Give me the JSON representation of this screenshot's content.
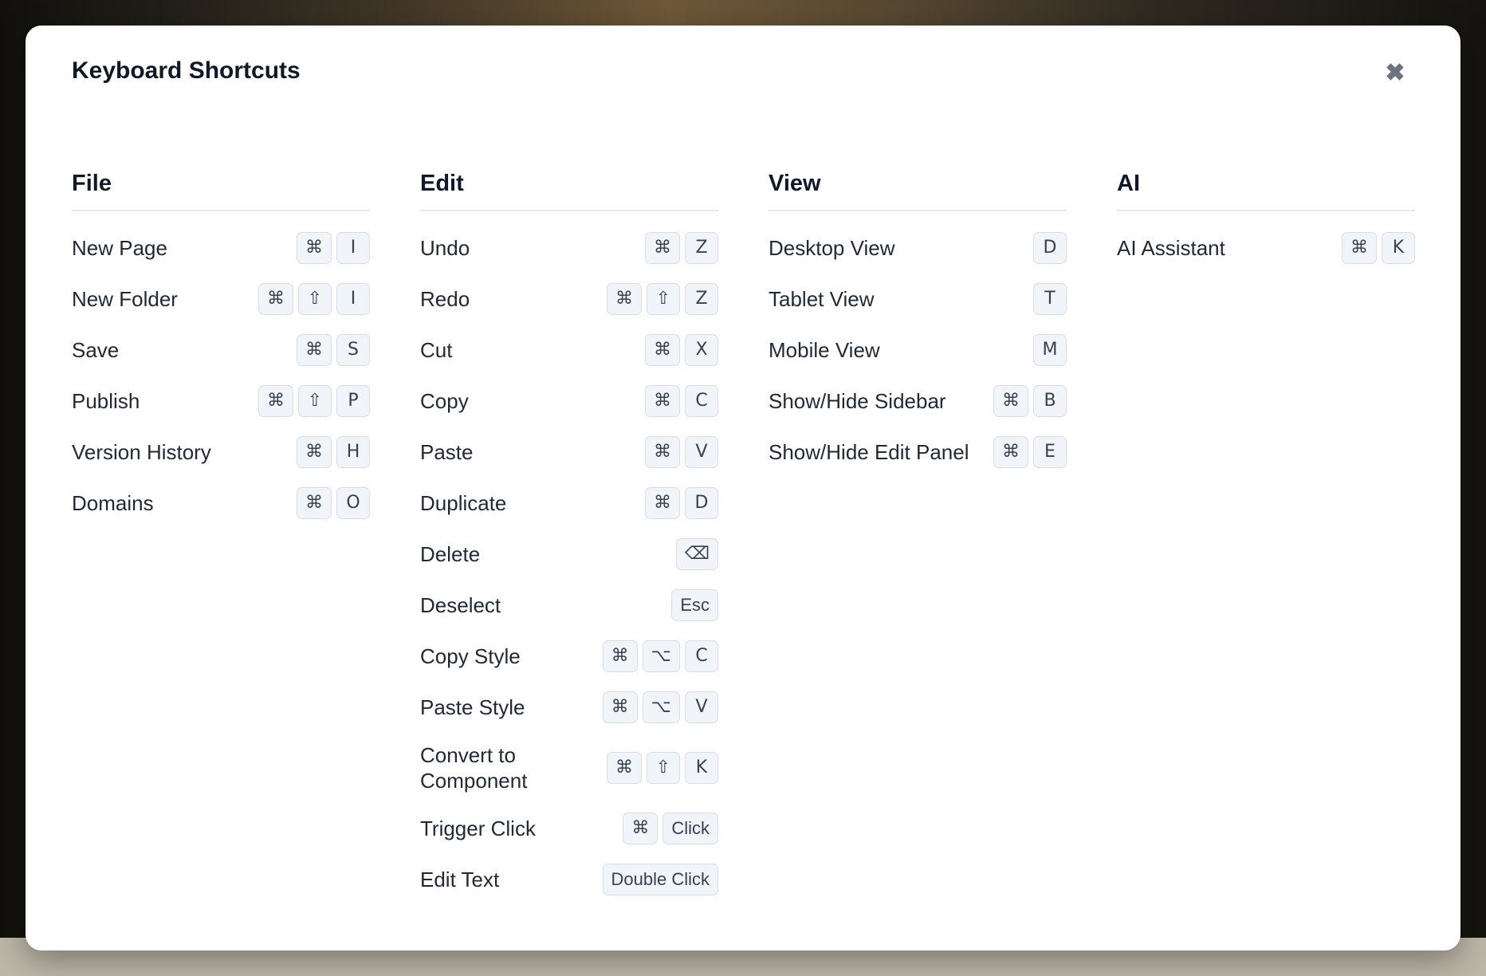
{
  "dialog": {
    "title": "Keyboard Shortcuts",
    "close_icon": "close-icon",
    "close_glyph": "✖"
  },
  "colors": {
    "title_text": "#111827",
    "key_background": "#f1f4f8",
    "key_border": "#d7dde6",
    "divider": "#e5e7eb"
  },
  "columns": [
    {
      "id": "file",
      "title": "File",
      "shortcuts": [
        {
          "label": "New Page",
          "keys": [
            "⌘",
            "I"
          ]
        },
        {
          "label": "New Folder",
          "keys": [
            "⌘",
            "⇧",
            "I"
          ]
        },
        {
          "label": "Save",
          "keys": [
            "⌘",
            "S"
          ]
        },
        {
          "label": "Publish",
          "keys": [
            "⌘",
            "⇧",
            "P"
          ]
        },
        {
          "label": "Version History",
          "keys": [
            "⌘",
            "H"
          ]
        },
        {
          "label": "Domains",
          "keys": [
            "⌘",
            "O"
          ]
        }
      ]
    },
    {
      "id": "edit",
      "title": "Edit",
      "shortcuts": [
        {
          "label": "Undo",
          "keys": [
            "⌘",
            "Z"
          ]
        },
        {
          "label": "Redo",
          "keys": [
            "⌘",
            "⇧",
            "Z"
          ]
        },
        {
          "label": "Cut",
          "keys": [
            "⌘",
            "X"
          ]
        },
        {
          "label": "Copy",
          "keys": [
            "⌘",
            "C"
          ]
        },
        {
          "label": "Paste",
          "keys": [
            "⌘",
            "V"
          ]
        },
        {
          "label": "Duplicate",
          "keys": [
            "⌘",
            "D"
          ]
        },
        {
          "label": "Delete",
          "keys": [
            "⌫"
          ]
        },
        {
          "label": "Deselect",
          "keys": [
            "Esc"
          ]
        },
        {
          "label": "Copy Style",
          "keys": [
            "⌘",
            "⌥",
            "C"
          ]
        },
        {
          "label": "Paste Style",
          "keys": [
            "⌘",
            "⌥",
            "V"
          ]
        },
        {
          "label": "Convert to Component",
          "keys": [
            "⌘",
            "⇧",
            "K"
          ]
        },
        {
          "label": "Trigger Click",
          "keys": [
            "⌘",
            "Click"
          ]
        },
        {
          "label": "Edit Text",
          "keys": [
            "Double Click"
          ]
        }
      ]
    },
    {
      "id": "view",
      "title": "View",
      "shortcuts": [
        {
          "label": "Desktop View",
          "keys": [
            "D"
          ]
        },
        {
          "label": "Tablet View",
          "keys": [
            "T"
          ]
        },
        {
          "label": "Mobile View",
          "keys": [
            "M"
          ]
        },
        {
          "label": "Show/Hide Sidebar",
          "keys": [
            "⌘",
            "B"
          ]
        },
        {
          "label": "Show/Hide Edit Panel",
          "keys": [
            "⌘",
            "E"
          ]
        }
      ]
    },
    {
      "id": "ai",
      "title": "AI",
      "shortcuts": [
        {
          "label": "AI Assistant",
          "keys": [
            "⌘",
            "K"
          ]
        }
      ]
    }
  ]
}
